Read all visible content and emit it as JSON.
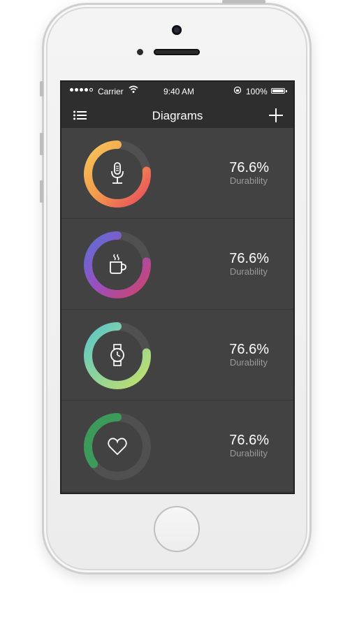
{
  "status_bar": {
    "carrier": "Carrier",
    "time": "9:40 AM",
    "battery": "100%"
  },
  "nav": {
    "title": "Diagrams",
    "menu_icon": "list-icon",
    "add_icon": "plus-icon"
  },
  "items": [
    {
      "icon": "microphone-icon",
      "value": "76.6%",
      "label": "Durability",
      "progress": 0.766,
      "colors": [
        "#e84a5f",
        "#f39a4b",
        "#f7c65a"
      ]
    },
    {
      "icon": "coffee-cup-icon",
      "value": "76.6%",
      "label": "Durability",
      "progress": 0.766,
      "colors": [
        "#d1436b",
        "#9a4fbf",
        "#5a6fd6"
      ]
    },
    {
      "icon": "watch-icon",
      "value": "76.6%",
      "label": "Durability",
      "progress": 0.766,
      "colors": [
        "#c3e06a",
        "#8fd39a",
        "#5cc7c9"
      ]
    },
    {
      "icon": "heart-icon",
      "value": "76.6%",
      "label": "Durability",
      "progress": 0.35,
      "colors": [
        "#3c9a5a",
        "#3c9a5a",
        "#3c9a5a"
      ]
    }
  ]
}
